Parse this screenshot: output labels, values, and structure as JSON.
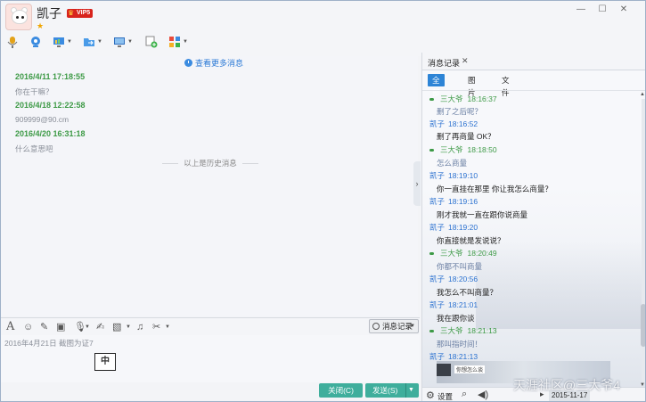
{
  "header": {
    "contact_name": "凯子",
    "vip_label": "VIP5",
    "window_controls": [
      "minimize",
      "maximize",
      "close"
    ]
  },
  "toolbar": {
    "icons": [
      "microphone-icon",
      "video-call-icon",
      "screen-share-icon",
      "file-transfer-icon",
      "remote-desktop-icon",
      "create-group-icon",
      "apps-icon"
    ]
  },
  "chat": {
    "more_messages_label": "查看更多消息",
    "messages": [
      {
        "time": "2016/4/11 17:18:55",
        "text": "你在干嘛？"
      },
      {
        "time": "2016/4/18 12:22:58",
        "text": "909999@90.cm"
      },
      {
        "time": "2016/4/20 16:31:18",
        "text": "什么意思吧"
      }
    ],
    "history_divider": "以上是历史消息"
  },
  "input": {
    "history_button": "消息记录",
    "draft_text": "2016年4月21日 截图为证7",
    "ime_indicator": "中",
    "close_button": "关闭(C)",
    "send_button": "发送(S)"
  },
  "record_panel": {
    "tab_title": "消息记录",
    "filters": [
      "全部",
      "图片",
      "文件"
    ],
    "active_filter": "全部",
    "entries": [
      {
        "sender": "三大爷",
        "time": "18:16:37",
        "text": "删了之后呢？",
        "me": false
      },
      {
        "sender": "凯子",
        "time": "18:16:52",
        "text": "删了再商量 OK？",
        "me": true
      },
      {
        "sender": "三大爷",
        "time": "18:18:50",
        "text": "怎么商量",
        "me": false
      },
      {
        "sender": "凯子",
        "time": "18:19:10",
        "text": "你一直挂在那里 你让我怎么商量？",
        "me": true
      },
      {
        "sender": "凯子",
        "time": "18:19:16",
        "text": "刚才我就一直在跟你说商量",
        "me": true
      },
      {
        "sender": "凯子",
        "time": "18:19:20",
        "text": "你直接就是发说说？",
        "me": true
      },
      {
        "sender": "三大爷",
        "time": "18:20:49",
        "text": "你都不叫商量",
        "me": false
      },
      {
        "sender": "凯子",
        "time": "18:20:56",
        "text": "我怎么不叫商量？",
        "me": true
      },
      {
        "sender": "凯子",
        "time": "18:21:01",
        "text": "我在跟你谈",
        "me": true
      },
      {
        "sender": "三大爷",
        "time": "18:21:13",
        "text": "那叫指时间！",
        "me": false
      },
      {
        "sender": "凯子",
        "time": "18:21:13",
        "text": "",
        "me": true
      }
    ],
    "thumb_caption": "你想怎么谈",
    "footer": {
      "settings_label": "设置",
      "date": "2015-11-17"
    }
  },
  "watermark": "天涯社区@三大爷4",
  "colors": {
    "accent_green": "#3fae9c",
    "time_green": "#3d9a46",
    "me_blue": "#2c72d0",
    "filter_active": "#2d84d6",
    "vip_red": "#d8231c"
  }
}
